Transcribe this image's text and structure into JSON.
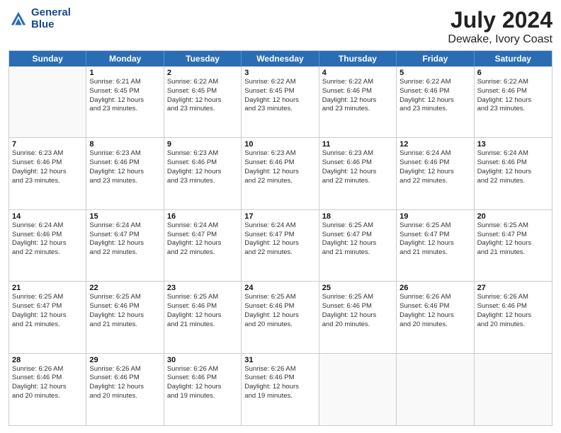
{
  "header": {
    "logo_line1": "General",
    "logo_line2": "Blue",
    "main_title": "July 2024",
    "subtitle": "Dewake, Ivory Coast"
  },
  "days": [
    "Sunday",
    "Monday",
    "Tuesday",
    "Wednesday",
    "Thursday",
    "Friday",
    "Saturday"
  ],
  "weeks": [
    [
      {
        "day": "",
        "empty": true
      },
      {
        "day": "1",
        "sunrise": "Sunrise: 6:21 AM",
        "sunset": "Sunset: 6:45 PM",
        "daylight": "Daylight: 12 hours",
        "minutes": "and 23 minutes."
      },
      {
        "day": "2",
        "sunrise": "Sunrise: 6:22 AM",
        "sunset": "Sunset: 6:45 PM",
        "daylight": "Daylight: 12 hours",
        "minutes": "and 23 minutes."
      },
      {
        "day": "3",
        "sunrise": "Sunrise: 6:22 AM",
        "sunset": "Sunset: 6:45 PM",
        "daylight": "Daylight: 12 hours",
        "minutes": "and 23 minutes."
      },
      {
        "day": "4",
        "sunrise": "Sunrise: 6:22 AM",
        "sunset": "Sunset: 6:46 PM",
        "daylight": "Daylight: 12 hours",
        "minutes": "and 23 minutes."
      },
      {
        "day": "5",
        "sunrise": "Sunrise: 6:22 AM",
        "sunset": "Sunset: 6:46 PM",
        "daylight": "Daylight: 12 hours",
        "minutes": "and 23 minutes."
      },
      {
        "day": "6",
        "sunrise": "Sunrise: 6:22 AM",
        "sunset": "Sunset: 6:46 PM",
        "daylight": "Daylight: 12 hours",
        "minutes": "and 23 minutes."
      }
    ],
    [
      {
        "day": "7",
        "sunrise": "Sunrise: 6:23 AM",
        "sunset": "Sunset: 6:46 PM",
        "daylight": "Daylight: 12 hours",
        "minutes": "and 23 minutes."
      },
      {
        "day": "8",
        "sunrise": "Sunrise: 6:23 AM",
        "sunset": "Sunset: 6:46 PM",
        "daylight": "Daylight: 12 hours",
        "minutes": "and 23 minutes."
      },
      {
        "day": "9",
        "sunrise": "Sunrise: 6:23 AM",
        "sunset": "Sunset: 6:46 PM",
        "daylight": "Daylight: 12 hours",
        "minutes": "and 23 minutes."
      },
      {
        "day": "10",
        "sunrise": "Sunrise: 6:23 AM",
        "sunset": "Sunset: 6:46 PM",
        "daylight": "Daylight: 12 hours",
        "minutes": "and 22 minutes."
      },
      {
        "day": "11",
        "sunrise": "Sunrise: 6:23 AM",
        "sunset": "Sunset: 6:46 PM",
        "daylight": "Daylight: 12 hours",
        "minutes": "and 22 minutes."
      },
      {
        "day": "12",
        "sunrise": "Sunrise: 6:24 AM",
        "sunset": "Sunset: 6:46 PM",
        "daylight": "Daylight: 12 hours",
        "minutes": "and 22 minutes."
      },
      {
        "day": "13",
        "sunrise": "Sunrise: 6:24 AM",
        "sunset": "Sunset: 6:46 PM",
        "daylight": "Daylight: 12 hours",
        "minutes": "and 22 minutes."
      }
    ],
    [
      {
        "day": "14",
        "sunrise": "Sunrise: 6:24 AM",
        "sunset": "Sunset: 6:46 PM",
        "daylight": "Daylight: 12 hours",
        "minutes": "and 22 minutes."
      },
      {
        "day": "15",
        "sunrise": "Sunrise: 6:24 AM",
        "sunset": "Sunset: 6:47 PM",
        "daylight": "Daylight: 12 hours",
        "minutes": "and 22 minutes."
      },
      {
        "day": "16",
        "sunrise": "Sunrise: 6:24 AM",
        "sunset": "Sunset: 6:47 PM",
        "daylight": "Daylight: 12 hours",
        "minutes": "and 22 minutes."
      },
      {
        "day": "17",
        "sunrise": "Sunrise: 6:24 AM",
        "sunset": "Sunset: 6:47 PM",
        "daylight": "Daylight: 12 hours",
        "minutes": "and 22 minutes."
      },
      {
        "day": "18",
        "sunrise": "Sunrise: 6:25 AM",
        "sunset": "Sunset: 6:47 PM",
        "daylight": "Daylight: 12 hours",
        "minutes": "and 21 minutes."
      },
      {
        "day": "19",
        "sunrise": "Sunrise: 6:25 AM",
        "sunset": "Sunset: 6:47 PM",
        "daylight": "Daylight: 12 hours",
        "minutes": "and 21 minutes."
      },
      {
        "day": "20",
        "sunrise": "Sunrise: 6:25 AM",
        "sunset": "Sunset: 6:47 PM",
        "daylight": "Daylight: 12 hours",
        "minutes": "and 21 minutes."
      }
    ],
    [
      {
        "day": "21",
        "sunrise": "Sunrise: 6:25 AM",
        "sunset": "Sunset: 6:47 PM",
        "daylight": "Daylight: 12 hours",
        "minutes": "and 21 minutes."
      },
      {
        "day": "22",
        "sunrise": "Sunrise: 6:25 AM",
        "sunset": "Sunset: 6:46 PM",
        "daylight": "Daylight: 12 hours",
        "minutes": "and 21 minutes."
      },
      {
        "day": "23",
        "sunrise": "Sunrise: 6:25 AM",
        "sunset": "Sunset: 6:46 PM",
        "daylight": "Daylight: 12 hours",
        "minutes": "and 21 minutes."
      },
      {
        "day": "24",
        "sunrise": "Sunrise: 6:25 AM",
        "sunset": "Sunset: 6:46 PM",
        "daylight": "Daylight: 12 hours",
        "minutes": "and 20 minutes."
      },
      {
        "day": "25",
        "sunrise": "Sunrise: 6:25 AM",
        "sunset": "Sunset: 6:46 PM",
        "daylight": "Daylight: 12 hours",
        "minutes": "and 20 minutes."
      },
      {
        "day": "26",
        "sunrise": "Sunrise: 6:26 AM",
        "sunset": "Sunset: 6:46 PM",
        "daylight": "Daylight: 12 hours",
        "minutes": "and 20 minutes."
      },
      {
        "day": "27",
        "sunrise": "Sunrise: 6:26 AM",
        "sunset": "Sunset: 6:46 PM",
        "daylight": "Daylight: 12 hours",
        "minutes": "and 20 minutes."
      }
    ],
    [
      {
        "day": "28",
        "sunrise": "Sunrise: 6:26 AM",
        "sunset": "Sunset: 6:46 PM",
        "daylight": "Daylight: 12 hours",
        "minutes": "and 20 minutes."
      },
      {
        "day": "29",
        "sunrise": "Sunrise: 6:26 AM",
        "sunset": "Sunset: 6:46 PM",
        "daylight": "Daylight: 12 hours",
        "minutes": "and 20 minutes."
      },
      {
        "day": "30",
        "sunrise": "Sunrise: 6:26 AM",
        "sunset": "Sunset: 6:46 PM",
        "daylight": "Daylight: 12 hours",
        "minutes": "and 19 minutes."
      },
      {
        "day": "31",
        "sunrise": "Sunrise: 6:26 AM",
        "sunset": "Sunset: 6:46 PM",
        "daylight": "Daylight: 12 hours",
        "minutes": "and 19 minutes."
      },
      {
        "day": "",
        "empty": true
      },
      {
        "day": "",
        "empty": true
      },
      {
        "day": "",
        "empty": true
      }
    ]
  ]
}
